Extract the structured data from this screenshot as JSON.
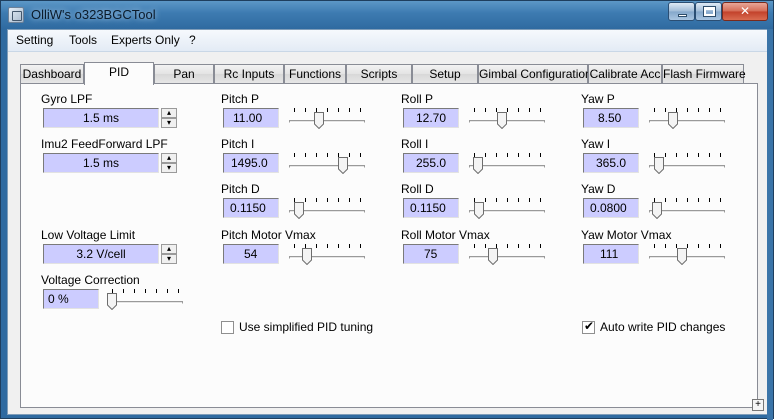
{
  "window": {
    "title": "OlliW's o323BGCTool"
  },
  "menu": {
    "items": [
      "Setting",
      "Tools",
      "Experts Only",
      "?"
    ]
  },
  "tabs": [
    "Dashboard",
    "PID",
    "Pan",
    "Rc Inputs",
    "Functions",
    "Scripts",
    "Setup",
    "Gimbal Configuration",
    "Calibrate Acc",
    "Flash Firmware"
  ],
  "active_tab": "PID",
  "pid": {
    "gyro_lpf": {
      "label": "Gyro LPF",
      "value": "1.5 ms"
    },
    "imu2_ff_lpf": {
      "label": "Imu2 FeedForward LPF",
      "value": "1.5 ms"
    },
    "low_voltage": {
      "label": "Low Voltage Limit",
      "value": "3.2 V/cell"
    },
    "voltage_corr": {
      "label": "Voltage Correction",
      "value": "0 %",
      "level": 0
    },
    "pitch_p": {
      "label": "Pitch P",
      "value": "11.00",
      "level": 0.38
    },
    "pitch_i": {
      "label": "Pitch I",
      "value": "1495.0",
      "level": 0.74
    },
    "pitch_d": {
      "label": "Pitch D",
      "value": "0.1150",
      "level": 0.08
    },
    "pitch_vmax": {
      "label": "Pitch Motor Vmax",
      "value": "54",
      "level": 0.2
    },
    "roll_p": {
      "label": "Roll P",
      "value": "12.70",
      "level": 0.43
    },
    "roll_i": {
      "label": "Roll I",
      "value": "255.0",
      "level": 0.06
    },
    "roll_d": {
      "label": "Roll D",
      "value": "0.1150",
      "level": 0.08
    },
    "roll_vmax": {
      "label": "Roll Motor Vmax",
      "value": "75",
      "level": 0.29
    },
    "yaw_p": {
      "label": "Yaw P",
      "value": "8.50",
      "level": 0.29
    },
    "yaw_i": {
      "label": "Yaw I",
      "value": "365.0",
      "level": 0.08
    },
    "yaw_d": {
      "label": "Yaw D",
      "value": "0.0800",
      "level": 0.05
    },
    "yaw_vmax": {
      "label": "Yaw Motor Vmax",
      "value": "111",
      "level": 0.43
    },
    "simplified": {
      "label": "Use simplified PID tuning",
      "checked": false
    },
    "autowrite": {
      "label": "Auto write PID changes",
      "checked": true
    }
  },
  "icons": {
    "resize": "+",
    "checkmark": "✔",
    "spin_up": "▴",
    "spin_down": "▾",
    "close": "✕"
  }
}
